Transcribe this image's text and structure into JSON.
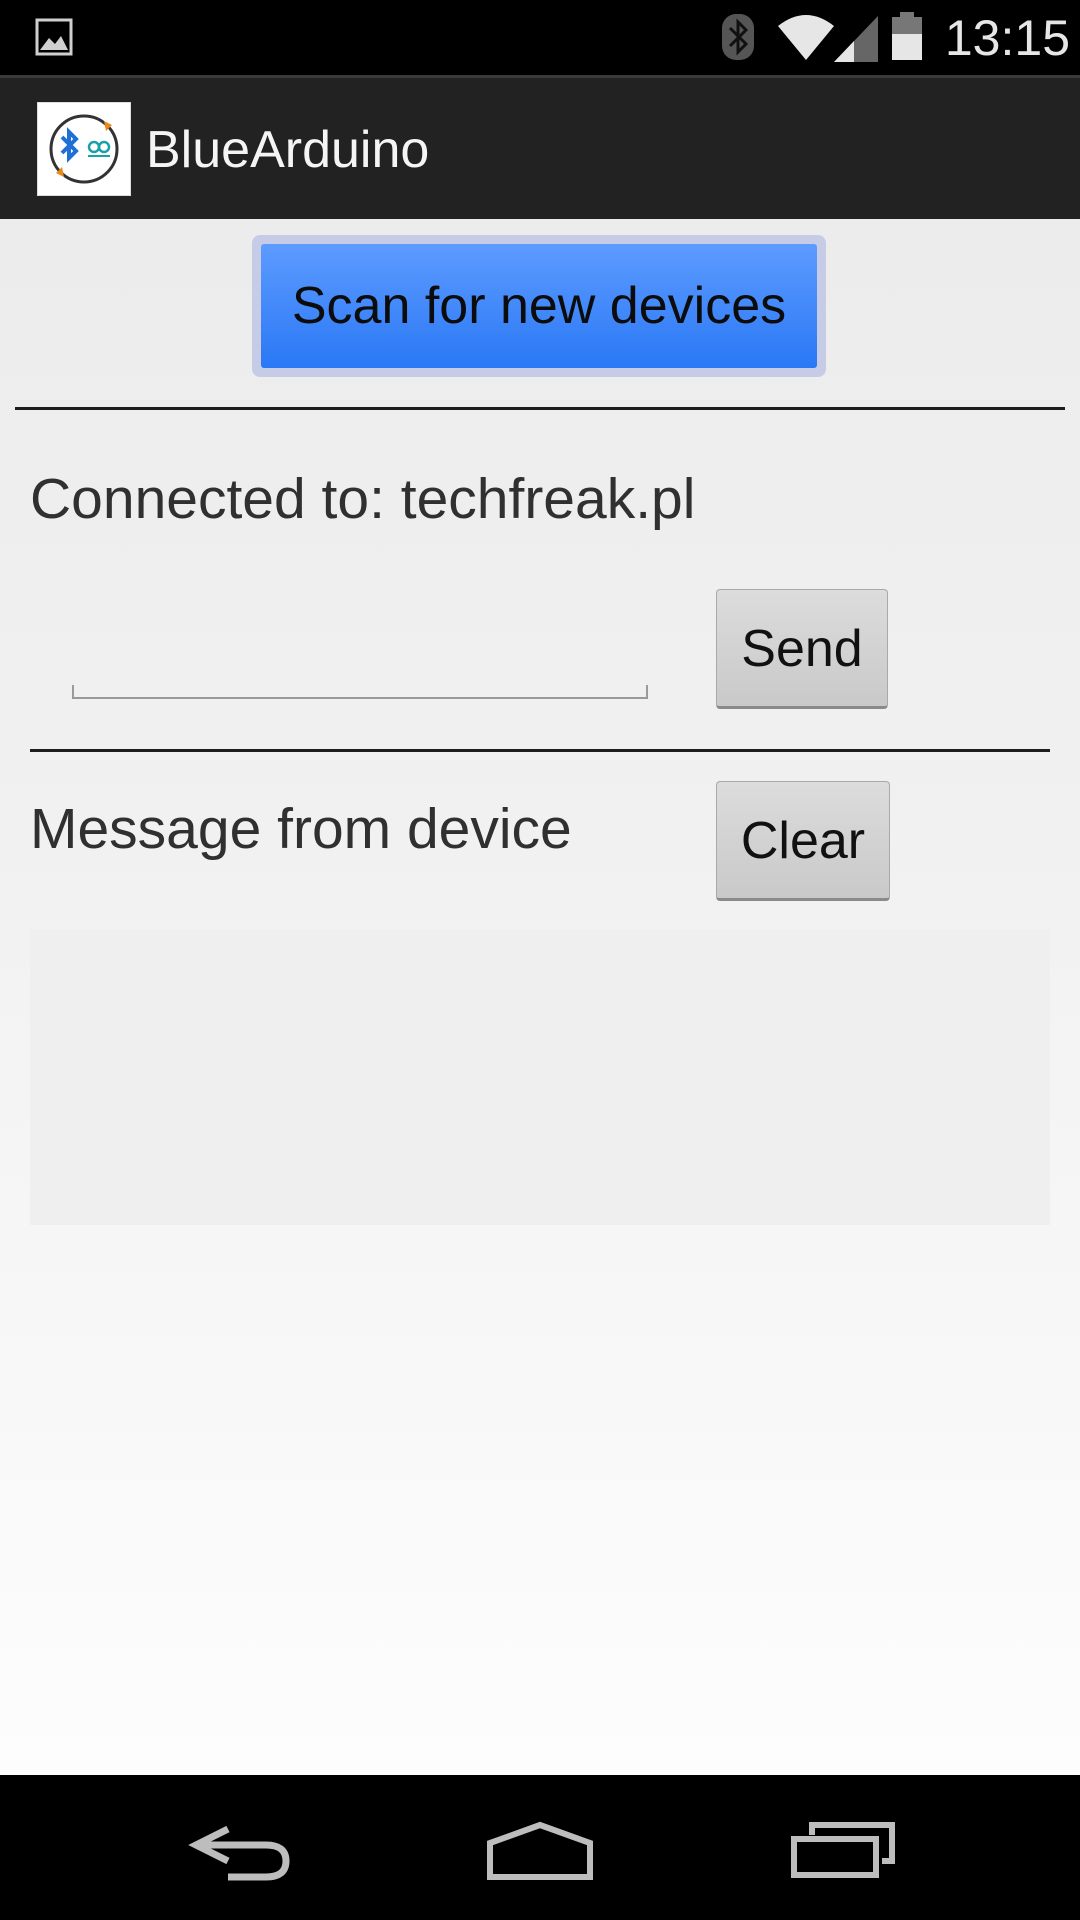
{
  "status_bar": {
    "time": "13:15",
    "icons": [
      "gallery-notification-icon",
      "bluetooth-icon",
      "wifi-icon",
      "cell-signal-icon",
      "battery-icon"
    ]
  },
  "action_bar": {
    "app_icon": "bluearduino-app-icon",
    "title": "BlueArduino"
  },
  "main": {
    "scan_button_label": "Scan for new devices",
    "connected_label": "Connected to: techfreak.pl",
    "message_input": {
      "value": "",
      "placeholder": ""
    },
    "send_button_label": "Send",
    "message_label": "Message from device",
    "clear_button_label": "Clear",
    "message_area_text": ""
  },
  "nav_bar": {
    "icons": [
      "back-icon",
      "home-icon",
      "recents-icon"
    ]
  },
  "colors": {
    "scan_button": "#3d86fb",
    "status_bar": "#000000",
    "action_bar": "#222222"
  }
}
